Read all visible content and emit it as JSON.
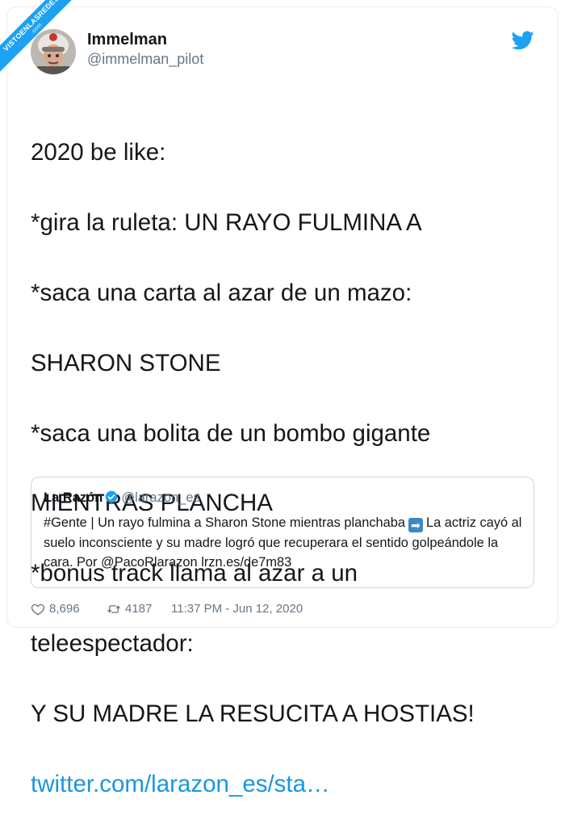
{
  "watermark": {
    "text": "VISTOENLASREDES",
    "subtext": ".com"
  },
  "author": {
    "name": "Immelman",
    "handle": "@immelman_pilot"
  },
  "tweet": {
    "lines": [
      "2020 be like:",
      "*gira la ruleta: UN RAYO FULMINA A",
      "*saca una carta al azar de un mazo:",
      "SHARON STONE",
      "*saca una bolita de un bombo gigante",
      "MIENTRAS PLANCHA",
      "*bonus track llama al azar a un",
      "teleespectador:",
      "Y SU MADRE LA RESUCITA A HOSTIAS!"
    ],
    "link": "twitter.com/larazon_es/sta…"
  },
  "quote": {
    "name": "La Razón",
    "handle": "@larazon_es",
    "text_before_emoji": "#Gente | Un rayo fulmina a Sharon Stone mientras planchaba",
    "emoji": "➡",
    "text_after_emoji": "La actriz cayó al suelo inconsciente y su madre logró que recuperara el sentido golpeándole la cara. Por @PacoRlarazon lrzn.es/de7m83"
  },
  "footer": {
    "likes": "8,696",
    "retweets": "4187",
    "timestamp": "11:37 PM - Jun 12, 2020"
  },
  "colors": {
    "twitter_blue": "#1da1f2",
    "link_blue": "#1b95e0",
    "muted_gray": "#657786",
    "border": "#ccd6dd"
  },
  "icons": [
    "twitter-bird-icon",
    "verified-badge-icon",
    "heart-icon",
    "retweet-icon",
    "arrow-right-emoji"
  ]
}
